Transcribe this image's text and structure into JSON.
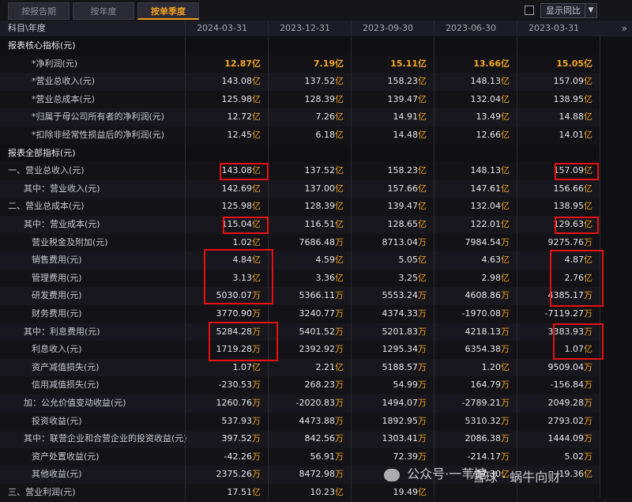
{
  "tabs": [
    {
      "label": "按报告期",
      "active": false
    },
    {
      "label": "按年度",
      "active": false
    },
    {
      "label": "按单季度",
      "active": true
    }
  ],
  "compare_label": "显示同比",
  "header": {
    "label": "科目\\年度",
    "periods": [
      "2024-03-31",
      "2023-12-31",
      "2023-09-30",
      "2023-06-30",
      "2023-03-31"
    ],
    "more_icon": "double-chevron-right"
  },
  "rows": [
    {
      "label": "报表核心指标(元)",
      "type": "section",
      "values": []
    },
    {
      "label": "*净利润(元)",
      "type": "key",
      "values": [
        "12.87亿",
        "7.19亿",
        "15.11亿",
        "13.66亿",
        "15.05亿"
      ]
    },
    {
      "label": "*营业总收入(元)",
      "type": "key2",
      "values": [
        "143.08亿",
        "137.52亿",
        "158.23亿",
        "148.13亿",
        "157.09亿"
      ]
    },
    {
      "label": "*营业总成本(元)",
      "type": "key2",
      "values": [
        "125.98亿",
        "128.39亿",
        "139.47亿",
        "132.04亿",
        "138.95亿"
      ]
    },
    {
      "label": "*归属于母公司所有者的净利润(元)",
      "type": "key2",
      "values": [
        "12.72亿",
        "7.26亿",
        "14.91亿",
        "13.49亿",
        "14.88亿"
      ]
    },
    {
      "label": "*扣除非经常性损益后的净利润(元)",
      "type": "key2",
      "values": [
        "12.45亿",
        "6.18亿",
        "14.48亿",
        "12.66亿",
        "14.01亿"
      ]
    },
    {
      "label": "报表全部指标(元)",
      "type": "section",
      "values": []
    },
    {
      "label": "一、营业总收入(元)",
      "type": "normal",
      "values": [
        "143.08亿",
        "137.52亿",
        "158.23亿",
        "148.13亿",
        "157.09亿"
      ]
    },
    {
      "label": "其中：营业收入(元)",
      "type": "sub",
      "values": [
        "142.69亿",
        "137.00亿",
        "157.66亿",
        "147.61亿",
        "156.66亿"
      ]
    },
    {
      "label": "二、营业总成本(元)",
      "type": "normal",
      "values": [
        "125.98亿",
        "128.39亿",
        "139.47亿",
        "132.04亿",
        "138.95亿"
      ]
    },
    {
      "label": "其中：营业成本(元)",
      "type": "sub",
      "values": [
        "115.04亿",
        "116.51亿",
        "128.65亿",
        "122.01亿",
        "129.63亿"
      ]
    },
    {
      "label": "营业税金及附加(元)",
      "type": "sub2",
      "values": [
        "1.02亿",
        "7686.48万",
        "8713.04万",
        "7984.54万",
        "9275.76万"
      ]
    },
    {
      "label": "销售费用(元)",
      "type": "sub2",
      "values": [
        "4.84亿",
        "4.59亿",
        "5.05亿",
        "4.63亿",
        "4.87亿"
      ]
    },
    {
      "label": "管理费用(元)",
      "type": "sub2",
      "values": [
        "3.13亿",
        "3.36亿",
        "3.25亿",
        "2.98亿",
        "2.76亿"
      ]
    },
    {
      "label": "研发费用(元)",
      "type": "sub2",
      "values": [
        "5030.07万",
        "5366.11万",
        "5553.24万",
        "4608.86万",
        "4385.17万"
      ]
    },
    {
      "label": "财务费用(元)",
      "type": "sub2",
      "values": [
        "3770.90万",
        "3240.77万",
        "4374.33万",
        "-1970.08万",
        "-7119.27万"
      ]
    },
    {
      "label": "其中：利息费用(元)",
      "type": "sub",
      "values": [
        "5284.28万",
        "5401.52万",
        "5201.83万",
        "4218.13万",
        "3383.93万"
      ]
    },
    {
      "label": "利息收入(元)",
      "type": "sub2",
      "values": [
        "1719.28万",
        "2392.92万",
        "1295.34万",
        "6354.38万",
        "1.07亿"
      ]
    },
    {
      "label": "资产减值损失(元)",
      "type": "sub2",
      "values": [
        "1.07亿",
        "2.21亿",
        "5188.57万",
        "1.20亿",
        "9509.04万"
      ]
    },
    {
      "label": "信用减值损失(元)",
      "type": "sub2",
      "values": [
        "-230.53万",
        "268.23万",
        "54.99万",
        "164.79万",
        "-156.84万"
      ]
    },
    {
      "label": "加：公允价值变动收益(元)",
      "type": "sub",
      "values": [
        "1260.76万",
        "-2020.83万",
        "1494.07万",
        "-2789.21万",
        "2049.28万"
      ]
    },
    {
      "label": "投资收益(元)",
      "type": "sub2",
      "values": [
        "537.93万",
        "4473.88万",
        "1892.95万",
        "5310.32万",
        "2793.02万"
      ]
    },
    {
      "label": "其中：联营企业和合营企业的投资收益(元)",
      "type": "sub",
      "values": [
        "397.52万",
        "842.56万",
        "1303.41万",
        "2086.38万",
        "1444.09万"
      ]
    },
    {
      "label": "资产处置收益(元)",
      "type": "sub2",
      "values": [
        "-42.26万",
        "56.91万",
        "72.39万",
        "-214.17万",
        "5.02万"
      ]
    },
    {
      "label": "其他收益(元)",
      "type": "sub2",
      "values": [
        "2375.26万",
        "8472.98万",
        "",
        "17.30亿",
        "19.36亿"
      ]
    },
    {
      "label": "三、营业利润(元)",
      "type": "normal",
      "values": [
        "17.51亿",
        "10.23亿",
        "19.49亿",
        "",
        ""
      ]
    }
  ],
  "watermark": {
    "left": "公众号·一苇馆",
    "right": "雪球 · 蜗牛向财"
  },
  "colors": {
    "accent": "#f5a623",
    "highlight_box": "#e81010"
  }
}
